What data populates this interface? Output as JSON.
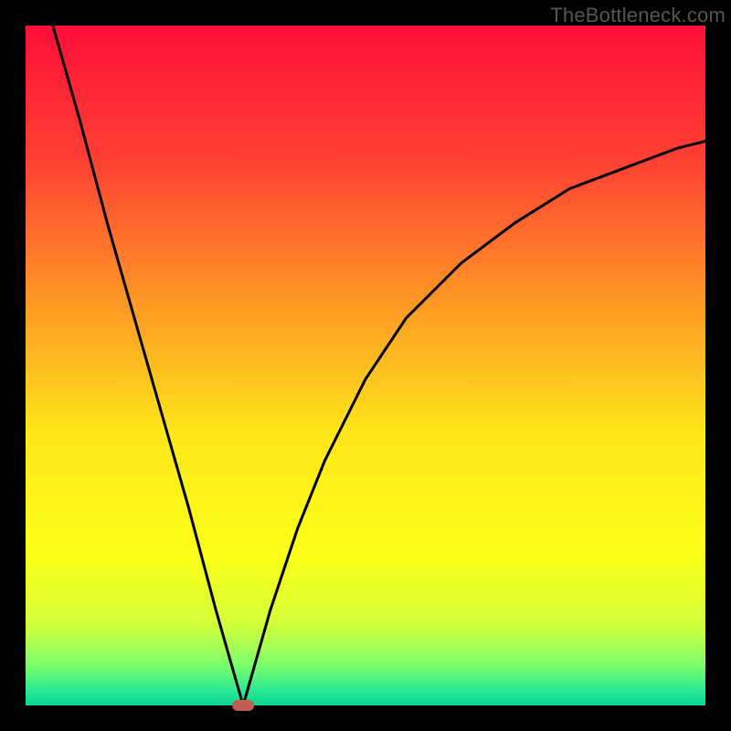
{
  "watermark": "TheBottleneck.com",
  "chart_data": {
    "type": "line",
    "title": "",
    "xlabel": "",
    "ylabel": "",
    "xlim": [
      0,
      100
    ],
    "ylim": [
      0,
      100
    ],
    "series": [
      {
        "name": "bottleneck-curve",
        "optimum_x": 32,
        "x": [
          4,
          8,
          12,
          16,
          20,
          24,
          28,
          30,
          32,
          34,
          36,
          40,
          44,
          50,
          56,
          64,
          72,
          80,
          88,
          96,
          100
        ],
        "values": [
          100,
          86,
          71,
          57,
          43,
          29,
          14,
          7,
          0,
          7,
          14,
          26,
          36,
          48,
          57,
          65,
          71,
          76,
          79,
          82,
          83
        ]
      }
    ],
    "marker": {
      "x": 32,
      "y": 0,
      "color": "#c06055"
    },
    "background": {
      "type": "vertical-gradient",
      "stops": [
        {
          "pct": 0,
          "color": "#ff0e38"
        },
        {
          "pct": 20,
          "color": "#ff4133"
        },
        {
          "pct": 42,
          "color": "#ff9d24"
        },
        {
          "pct": 60,
          "color": "#ffe61a"
        },
        {
          "pct": 78,
          "color": "#fbff18"
        },
        {
          "pct": 88,
          "color": "#d4ff38"
        },
        {
          "pct": 94,
          "color": "#7dff6a"
        },
        {
          "pct": 98,
          "color": "#25e896"
        },
        {
          "pct": 100,
          "color": "#0ed492"
        }
      ]
    },
    "frame_color": "#000000",
    "frame_thickness_px": 28
  }
}
